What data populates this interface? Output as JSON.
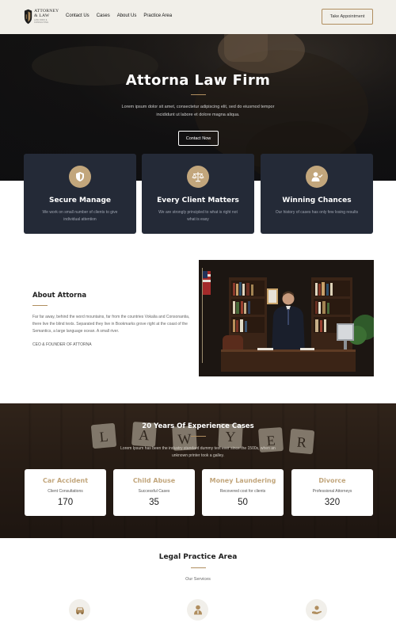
{
  "brand": {
    "logo_line1": "ATTORNEY",
    "logo_line2": "& LAW",
    "logo_tagline": "LAW FIRM & CONSULTING",
    "accent_color": "#b08e5f",
    "dark_color": "#242a37",
    "logo_icon": "law-shield-logo-icon"
  },
  "nav": {
    "items": [
      "Contact Us",
      "Cases",
      "About Us",
      "Practice Area"
    ],
    "cta": "Take Appointment"
  },
  "hero": {
    "title": "Attorna Law Firm",
    "description": "Lorem ipsum dolor sit amet, consectetur adipiscing elit, sed do eiusmod tempor incididunt ut labore et dolore magna aliqua.",
    "button": "Contact Now"
  },
  "features": [
    {
      "icon": "shield-icon",
      "title": "Secure Manage",
      "text": "We work on small number of clients to give individual attention"
    },
    {
      "icon": "scales-icon",
      "title": "Every Client Matters",
      "text": "We are strongly principled to what is right not what is easy"
    },
    {
      "icon": "user-check-icon",
      "title": "Winning Chances",
      "text": "Our history of cases has only few losing results"
    }
  ],
  "about": {
    "title": "About Attorna",
    "text": "Far far away, behind the word mountains, far from the countries Vokalia and Consonantia, there live the blind texts. Separated they live in Bookmarks grove right at the coast of the Semantics, a large language ocean. A small river.",
    "signature": "CEO & FOUNDER OF ATTORNA",
    "photo": "lawyer-office-photo"
  },
  "stats": {
    "background_tiles": [
      "L",
      "A",
      "W",
      "Y",
      "E",
      "R"
    ],
    "title": "20 Years Of Experience Cases",
    "description": "Lorem Ipsum has been the industry standard dummy text ever since the 1500s, when an unknown printer took a galley.",
    "cards": [
      {
        "title": "Car Accident",
        "label": "Client Consultations",
        "value": "170"
      },
      {
        "title": "Child Abuse",
        "label": "Successful Cases",
        "value": "35"
      },
      {
        "title": "Money Laundering",
        "label": "Recovered cost for clients",
        "value": "50"
      },
      {
        "title": "Divorce",
        "label": "Professional Attorneys",
        "value": "320"
      }
    ]
  },
  "practice": {
    "title": "Legal Practice Area",
    "subtitle": "Our Services",
    "icons": [
      "car-accident-icon",
      "family-user-icon",
      "hand-money-icon"
    ]
  }
}
